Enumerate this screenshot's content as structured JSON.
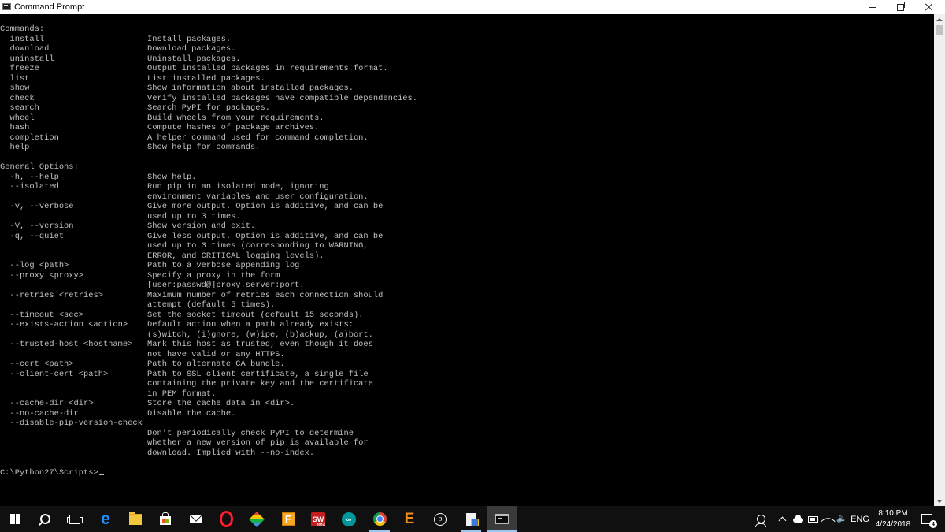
{
  "window": {
    "title": "Command Prompt"
  },
  "console": {
    "lines": [
      "Commands:",
      "  install                     Install packages.",
      "  download                    Download packages.",
      "  uninstall                   Uninstall packages.",
      "  freeze                      Output installed packages in requirements format.",
      "  list                        List installed packages.",
      "  show                        Show information about installed packages.",
      "  check                       Verify installed packages have compatible dependencies.",
      "  search                      Search PyPI for packages.",
      "  wheel                       Build wheels from your requirements.",
      "  hash                        Compute hashes of package archives.",
      "  completion                  A helper command used for command completion.",
      "  help                        Show help for commands.",
      "",
      "General Options:",
      "  -h, --help                  Show help.",
      "  --isolated                  Run pip in an isolated mode, ignoring",
      "                              environment variables and user configuration.",
      "  -v, --verbose               Give more output. Option is additive, and can be",
      "                              used up to 3 times.",
      "  -V, --version               Show version and exit.",
      "  -q, --quiet                 Give less output. Option is additive, and can be",
      "                              used up to 3 times (corresponding to WARNING,",
      "                              ERROR, and CRITICAL logging levels).",
      "  --log <path>                Path to a verbose appending log.",
      "  --proxy <proxy>             Specify a proxy in the form",
      "                              [user:passwd@]proxy.server:port.",
      "  --retries <retries>         Maximum number of retries each connection should",
      "                              attempt (default 5 times).",
      "  --timeout <sec>             Set the socket timeout (default 15 seconds).",
      "  --exists-action <action>    Default action when a path already exists:",
      "                              (s)witch, (i)gnore, (w)ipe, (b)ackup, (a)bort.",
      "  --trusted-host <hostname>   Mark this host as trusted, even though it does",
      "                              not have valid or any HTTPS.",
      "  --cert <path>               Path to alternate CA bundle.",
      "  --client-cert <path>        Path to SSL client certificate, a single file",
      "                              containing the private key and the certificate",
      "                              in PEM format.",
      "  --cache-dir <dir>           Store the cache data in <dir>.",
      "  --no-cache-dir              Disable the cache.",
      "  --disable-pip-version-check",
      "                              Don't periodically check PyPI to determine",
      "                              whether a new version of pip is available for",
      "                              download. Implied with --no-index.",
      ""
    ],
    "prompt": "C:\\Python27\\Scripts>"
  },
  "taskbar": {
    "apps": [
      {
        "name": "start-icon"
      },
      {
        "name": "search-icon"
      },
      {
        "name": "task-view-icon"
      },
      {
        "name": "edge-icon"
      },
      {
        "name": "file-explorer-icon"
      },
      {
        "name": "store-icon"
      },
      {
        "name": "mail-icon"
      },
      {
        "name": "opera-icon"
      },
      {
        "name": "visual-studio-icon"
      },
      {
        "name": "f-app-icon"
      },
      {
        "name": "solidworks-icon",
        "label": "SW"
      },
      {
        "name": "arduino-icon",
        "label": "∞"
      },
      {
        "name": "chrome-icon"
      },
      {
        "name": "e-app-icon",
        "label": "E"
      },
      {
        "name": "p-app-icon",
        "label": "p"
      },
      {
        "name": "document-icon"
      },
      {
        "name": "command-prompt-icon"
      }
    ],
    "tray": {
      "language": "ENG",
      "time": "8:10 PM",
      "date": "4/24/2018",
      "notification_count": "4"
    }
  },
  "colors": {
    "console_bg": "#000000",
    "console_fg": "#c0c0c0",
    "taskbar_bg": "#101010",
    "accent": "#9ac7f0"
  }
}
